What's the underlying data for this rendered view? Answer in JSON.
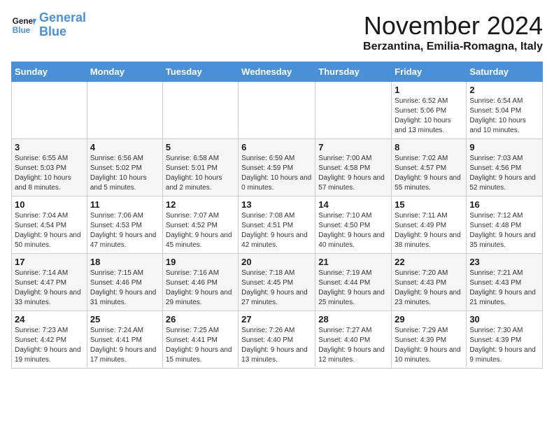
{
  "header": {
    "logo_general": "General",
    "logo_blue": "Blue",
    "month_title": "November 2024",
    "location": "Berzantina, Emilia-Romagna, Italy"
  },
  "weekdays": [
    "Sunday",
    "Monday",
    "Tuesday",
    "Wednesday",
    "Thursday",
    "Friday",
    "Saturday"
  ],
  "weeks": [
    [
      {
        "day": "",
        "info": ""
      },
      {
        "day": "",
        "info": ""
      },
      {
        "day": "",
        "info": ""
      },
      {
        "day": "",
        "info": ""
      },
      {
        "day": "",
        "info": ""
      },
      {
        "day": "1",
        "info": "Sunrise: 6:52 AM\nSunset: 5:06 PM\nDaylight: 10 hours and 13 minutes."
      },
      {
        "day": "2",
        "info": "Sunrise: 6:54 AM\nSunset: 5:04 PM\nDaylight: 10 hours and 10 minutes."
      }
    ],
    [
      {
        "day": "3",
        "info": "Sunrise: 6:55 AM\nSunset: 5:03 PM\nDaylight: 10 hours and 8 minutes."
      },
      {
        "day": "4",
        "info": "Sunrise: 6:56 AM\nSunset: 5:02 PM\nDaylight: 10 hours and 5 minutes."
      },
      {
        "day": "5",
        "info": "Sunrise: 6:58 AM\nSunset: 5:01 PM\nDaylight: 10 hours and 2 minutes."
      },
      {
        "day": "6",
        "info": "Sunrise: 6:59 AM\nSunset: 4:59 PM\nDaylight: 10 hours and 0 minutes."
      },
      {
        "day": "7",
        "info": "Sunrise: 7:00 AM\nSunset: 4:58 PM\nDaylight: 9 hours and 57 minutes."
      },
      {
        "day": "8",
        "info": "Sunrise: 7:02 AM\nSunset: 4:57 PM\nDaylight: 9 hours and 55 minutes."
      },
      {
        "day": "9",
        "info": "Sunrise: 7:03 AM\nSunset: 4:56 PM\nDaylight: 9 hours and 52 minutes."
      }
    ],
    [
      {
        "day": "10",
        "info": "Sunrise: 7:04 AM\nSunset: 4:54 PM\nDaylight: 9 hours and 50 minutes."
      },
      {
        "day": "11",
        "info": "Sunrise: 7:06 AM\nSunset: 4:53 PM\nDaylight: 9 hours and 47 minutes."
      },
      {
        "day": "12",
        "info": "Sunrise: 7:07 AM\nSunset: 4:52 PM\nDaylight: 9 hours and 45 minutes."
      },
      {
        "day": "13",
        "info": "Sunrise: 7:08 AM\nSunset: 4:51 PM\nDaylight: 9 hours and 42 minutes."
      },
      {
        "day": "14",
        "info": "Sunrise: 7:10 AM\nSunset: 4:50 PM\nDaylight: 9 hours and 40 minutes."
      },
      {
        "day": "15",
        "info": "Sunrise: 7:11 AM\nSunset: 4:49 PM\nDaylight: 9 hours and 38 minutes."
      },
      {
        "day": "16",
        "info": "Sunrise: 7:12 AM\nSunset: 4:48 PM\nDaylight: 9 hours and 35 minutes."
      }
    ],
    [
      {
        "day": "17",
        "info": "Sunrise: 7:14 AM\nSunset: 4:47 PM\nDaylight: 9 hours and 33 minutes."
      },
      {
        "day": "18",
        "info": "Sunrise: 7:15 AM\nSunset: 4:46 PM\nDaylight: 9 hours and 31 minutes."
      },
      {
        "day": "19",
        "info": "Sunrise: 7:16 AM\nSunset: 4:46 PM\nDaylight: 9 hours and 29 minutes."
      },
      {
        "day": "20",
        "info": "Sunrise: 7:18 AM\nSunset: 4:45 PM\nDaylight: 9 hours and 27 minutes."
      },
      {
        "day": "21",
        "info": "Sunrise: 7:19 AM\nSunset: 4:44 PM\nDaylight: 9 hours and 25 minutes."
      },
      {
        "day": "22",
        "info": "Sunrise: 7:20 AM\nSunset: 4:43 PM\nDaylight: 9 hours and 23 minutes."
      },
      {
        "day": "23",
        "info": "Sunrise: 7:21 AM\nSunset: 4:43 PM\nDaylight: 9 hours and 21 minutes."
      }
    ],
    [
      {
        "day": "24",
        "info": "Sunrise: 7:23 AM\nSunset: 4:42 PM\nDaylight: 9 hours and 19 minutes."
      },
      {
        "day": "25",
        "info": "Sunrise: 7:24 AM\nSunset: 4:41 PM\nDaylight: 9 hours and 17 minutes."
      },
      {
        "day": "26",
        "info": "Sunrise: 7:25 AM\nSunset: 4:41 PM\nDaylight: 9 hours and 15 minutes."
      },
      {
        "day": "27",
        "info": "Sunrise: 7:26 AM\nSunset: 4:40 PM\nDaylight: 9 hours and 13 minutes."
      },
      {
        "day": "28",
        "info": "Sunrise: 7:27 AM\nSunset: 4:40 PM\nDaylight: 9 hours and 12 minutes."
      },
      {
        "day": "29",
        "info": "Sunrise: 7:29 AM\nSunset: 4:39 PM\nDaylight: 9 hours and 10 minutes."
      },
      {
        "day": "30",
        "info": "Sunrise: 7:30 AM\nSunset: 4:39 PM\nDaylight: 9 hours and 9 minutes."
      }
    ]
  ]
}
